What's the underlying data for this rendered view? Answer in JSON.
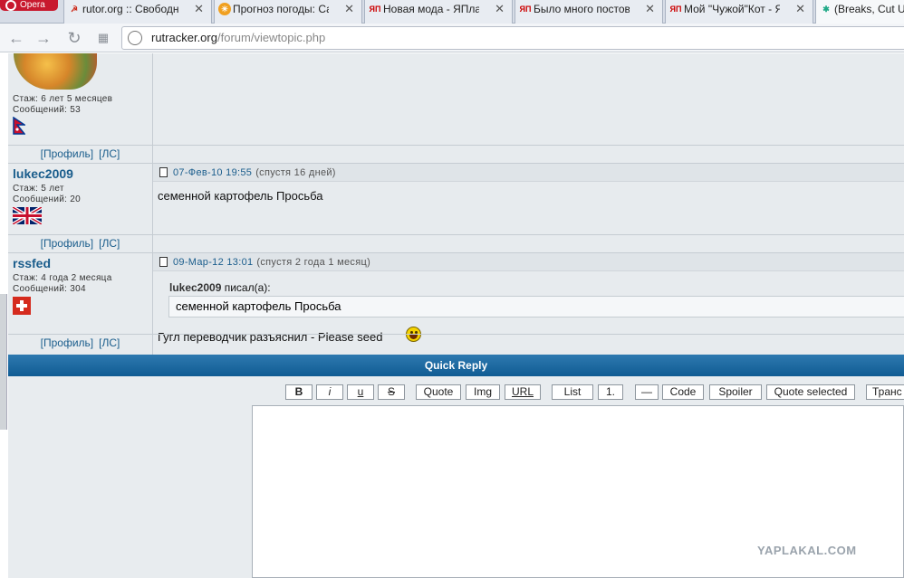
{
  "browser": {
    "brand": "Opera",
    "tabs": [
      {
        "label": "rutor.org :: Свободный торрент",
        "favicon": "hammer-sickle-icon"
      },
      {
        "label": "Прогноз погоды: Санкт",
        "favicon": "weather-icon"
      },
      {
        "label": "Новая мода - ЯПлакалъ",
        "favicon": "yap-icon"
      },
      {
        "label": "Было много постов",
        "favicon": "yap-icon"
      },
      {
        "label": "Мой \"Чужой\"Кот - ЯПлакалъ",
        "favicon": "yap-icon"
      },
      {
        "label": "(Breaks, Cut U",
        "favicon": "peacock-icon"
      }
    ],
    "tab_close": "✕",
    "yap_fav": "ЯП",
    "url_host": "rutracker.org",
    "url_path": "/forum/viewtopic.php"
  },
  "posts": [
    {
      "username": "",
      "stazh": "Стаж: 6 лет 5 месяцев",
      "messages": "Сообщений: 53",
      "flag": "nepal",
      "profile": "[Профиль]",
      "pm": "[ЛС]"
    },
    {
      "username": "lukec2009",
      "stazh": "Стаж: 5 лет",
      "messages": "Сообщений: 20",
      "flag": "uk",
      "profile": "[Профиль]",
      "pm": "[ЛС]",
      "date": "07-Фев-10 19:55",
      "since": "(спустя 16 дней)",
      "text": "семенной картофель Просьба"
    },
    {
      "username": "rssfed",
      "stazh": "Стаж: 4 года 2 месяца",
      "messages": "Сообщений: 304",
      "flag": "switzerland",
      "profile": "[Профиль]",
      "pm": "[ЛС]",
      "date": "09-Мар-12 13:01",
      "since": "(спустя 2 года 1 месяц)",
      "quote_author": "lukec2009",
      "quote_wrote": "писал(а):",
      "quote_text": "семенной картофель Просьба",
      "text": "Гугл переводчик разъяснил - Please seed"
    }
  ],
  "quick_reply": {
    "title": "Quick Reply",
    "buttons": {
      "bold": "B",
      "italic": "i",
      "underline": "u",
      "strike": "S",
      "quote": "Quote",
      "img": "Img",
      "url": "URL",
      "list": "List",
      "ordered": "1.",
      "hr": "—",
      "code": "Code",
      "spoiler": "Spoiler",
      "quote_selected": "Quote selected",
      "translit": "Транс"
    }
  },
  "watermark": "YAPLAKAL.COM",
  "colors": {
    "link": "#1a5d8c",
    "header_blue": "#105c93",
    "post_bg": "#e7ebee"
  }
}
